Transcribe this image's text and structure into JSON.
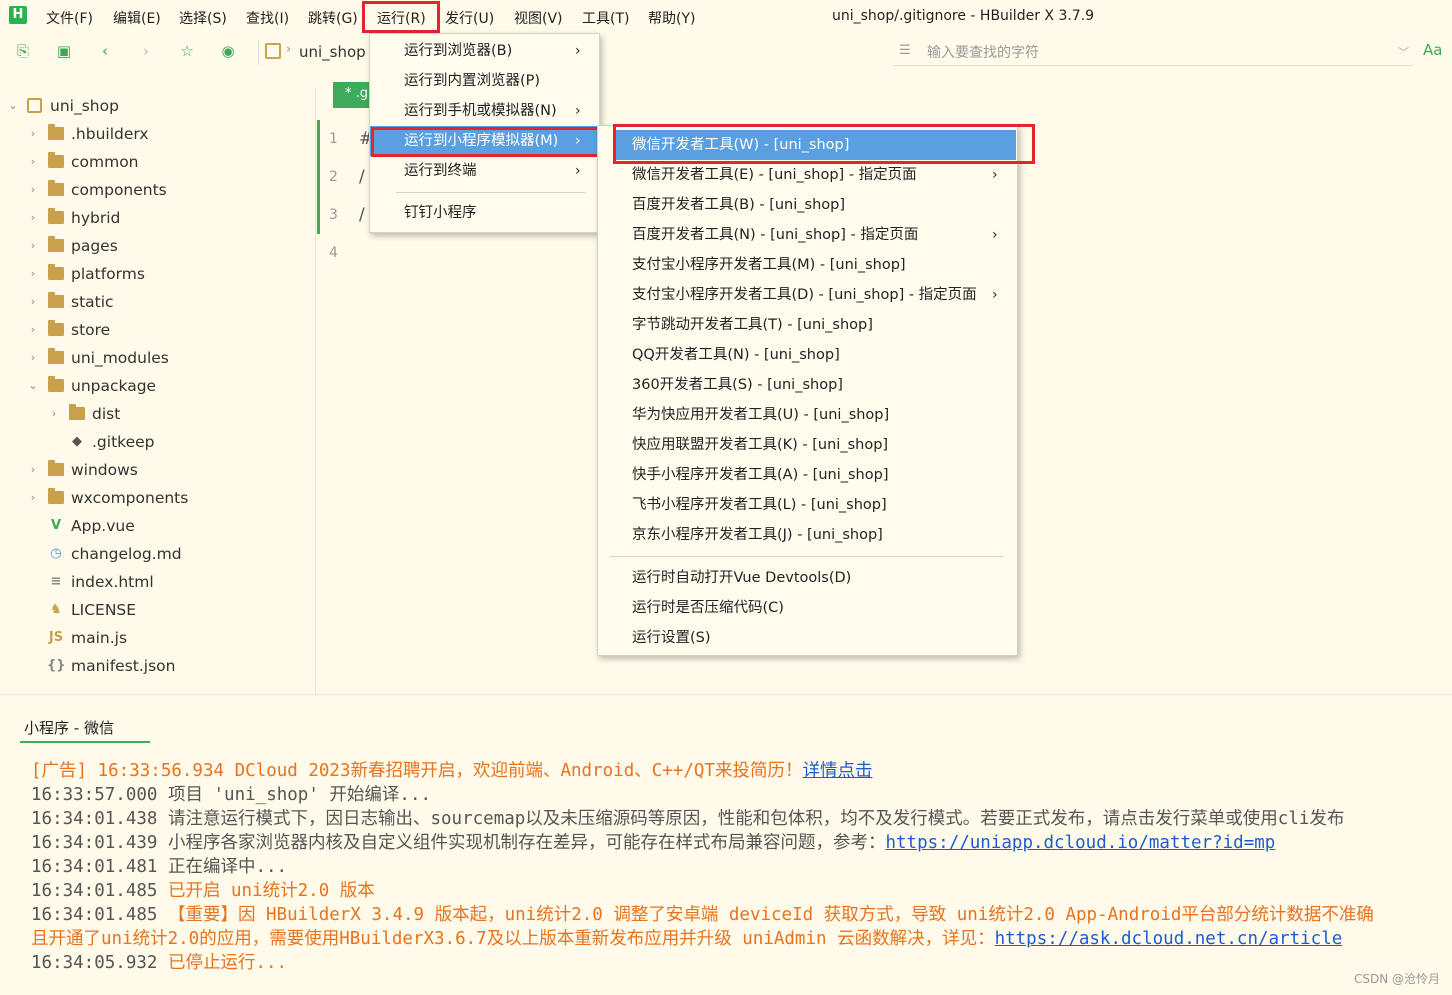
{
  "window": {
    "title": "uni_shop/.gitignore - HBuilder X 3.7.9",
    "logo": "H"
  },
  "menubar": [
    "文件(F)",
    "编辑(E)",
    "选择(S)",
    "查找(I)",
    "跳转(G)",
    "运行(R)",
    "发行(U)",
    "视图(V)",
    "工具(T)",
    "帮助(Y)"
  ],
  "toolbar": {
    "breadcrumb": "uni_shop",
    "search_placeholder": "输入要查找的字符",
    "font_button": "Aa"
  },
  "sidebar": {
    "tree": [
      {
        "label": "uni_shop",
        "kind": "project",
        "expanded": true,
        "depth": 0
      },
      {
        "label": ".hbuilderx",
        "kind": "folder",
        "depth": 1
      },
      {
        "label": "common",
        "kind": "folder",
        "depth": 1
      },
      {
        "label": "components",
        "kind": "folder",
        "depth": 1
      },
      {
        "label": "hybrid",
        "kind": "folder",
        "depth": 1
      },
      {
        "label": "pages",
        "kind": "folder",
        "depth": 1
      },
      {
        "label": "platforms",
        "kind": "folder",
        "depth": 1
      },
      {
        "label": "static",
        "kind": "folder",
        "depth": 1
      },
      {
        "label": "store",
        "kind": "folder",
        "depth": 1
      },
      {
        "label": "uni_modules",
        "kind": "folder",
        "depth": 1
      },
      {
        "label": "unpackage",
        "kind": "folder-open",
        "expanded": true,
        "depth": 1
      },
      {
        "label": "dist",
        "kind": "folder",
        "depth": 2
      },
      {
        "label": ".gitkeep",
        "kind": "git-file",
        "depth": 2
      },
      {
        "label": "windows",
        "kind": "folder",
        "depth": 1
      },
      {
        "label": "wxcomponents",
        "kind": "folder",
        "depth": 1
      },
      {
        "label": "App.vue",
        "kind": "vue-file",
        "depth": 1
      },
      {
        "label": "changelog.md",
        "kind": "md-file",
        "depth": 1
      },
      {
        "label": "index.html",
        "kind": "html-file",
        "depth": 1
      },
      {
        "label": "LICENSE",
        "kind": "license-file",
        "depth": 1
      },
      {
        "label": "main.js",
        "kind": "js-file",
        "depth": 1
      },
      {
        "label": "manifest.json",
        "kind": "json-file",
        "depth": 1
      }
    ]
  },
  "editor": {
    "tab_label": "* .g",
    "lines": [
      {
        "num": "1",
        "text": "#"
      },
      {
        "num": "2",
        "text": "/"
      },
      {
        "num": "3",
        "text": "/"
      },
      {
        "num": "4",
        "text": ""
      }
    ]
  },
  "run_menu": [
    {
      "label": "运行到浏览器(B)",
      "submenu": true
    },
    {
      "label": "运行到内置浏览器(P)",
      "submenu": false
    },
    {
      "label": "运行到手机或模拟器(N)",
      "submenu": true
    },
    {
      "label": "运行到小程序模拟器(M)",
      "submenu": true,
      "highlighted": true
    },
    {
      "label": "运行到终端",
      "submenu": true
    },
    {
      "label": "钉钉小程序",
      "submenu": false,
      "separator_before": true
    }
  ],
  "mp_submenu": {
    "items": [
      {
        "label": "微信开发者工具(W) - [uni_shop]",
        "highlighted": true
      },
      {
        "label": "微信开发者工具(E) - [uni_shop] - 指定页面",
        "submenu": true
      },
      {
        "label": "百度开发者工具(B) - [uni_shop]"
      },
      {
        "label": "百度开发者工具(N) - [uni_shop] - 指定页面",
        "submenu": true
      },
      {
        "label": "支付宝小程序开发者工具(M) - [uni_shop]"
      },
      {
        "label": "支付宝小程序开发者工具(D) - [uni_shop] - 指定页面",
        "submenu": true
      },
      {
        "label": "字节跳动开发者工具(T) - [uni_shop]"
      },
      {
        "label": "QQ开发者工具(N) - [uni_shop]"
      },
      {
        "label": "360开发者工具(S) - [uni_shop]"
      },
      {
        "label": "华为快应用开发者工具(U) - [uni_shop]"
      },
      {
        "label": "快应用联盟开发者工具(K) - [uni_shop]"
      },
      {
        "label": "快手小程序开发者工具(A) - [uni_shop]"
      },
      {
        "label": "飞书小程序开发者工具(L) - [uni_shop]"
      },
      {
        "label": "京东小程序开发者工具(J) - [uni_shop]"
      }
    ],
    "options": [
      {
        "label": "运行时自动打开Vue Devtools(D)"
      },
      {
        "label": "运行时是否压缩代码(C)"
      },
      {
        "label": "运行设置(S)"
      }
    ]
  },
  "console": {
    "tab": "小程序 - 微信",
    "lines": [
      {
        "time": "[广告] 16:33:56.934",
        "text": "DCloud 2023新春招聘开启，欢迎前端、Android、C++/QT来投简历！",
        "link": "详情点击",
        "orange": true,
        "time_orange": true
      },
      {
        "time": "16:33:57.000",
        "text": "项目 'uni_shop' 开始编译...",
        "link": "",
        "orange": false
      },
      {
        "time": "16:34:01.438",
        "text": "请注意运行模式下，因日志输出、sourcemap以及未压缩源码等原因，性能和包体积，均不及发行模式。若要正式发布，请点击发行菜单或使用cli发布",
        "link": "",
        "orange": false
      },
      {
        "time": "16:34:01.439",
        "text": "小程序各家浏览器内核及自定义组件实现机制存在差异，可能存在样式布局兼容问题，参考：",
        "link": "https://uniapp.dcloud.io/matter?id=mp",
        "orange": false
      },
      {
        "time": "16:34:01.481",
        "text": "正在编译中...",
        "link": "",
        "orange": false
      },
      {
        "time": "16:34:01.485",
        "text": "已开启 uni统计2.0 版本",
        "link": "",
        "orange": true
      },
      {
        "time": "16:34:01.485",
        "text": "【重要】因 HBuilderX 3.4.9 版本起，uni统计2.0 调整了安卓端 deviceId 获取方式，导致 uni统计2.0 App-Android平台部分统计数据不准确",
        "link": "",
        "orange": true
      },
      {
        "time": "",
        "text": "且开通了uni统计2.0的应用，需要使用HBuilderX3.6.7及以上版本重新发布应用并升级 uniAdmin 云函数解决，详见：",
        "link": "https://ask.dcloud.net.cn/article",
        "orange": true,
        "continuation": true
      },
      {
        "time": "16:34:05.932",
        "text": "已停止运行...",
        "link": "",
        "orange": true
      }
    ]
  },
  "watermark": "CSDN @沧怜月",
  "colors": {
    "accent": "#3dab5a",
    "highlight": "#5a9fe0",
    "annotation": "#e3262e",
    "warn": "#e8731e",
    "link": "#1d5bd1"
  }
}
